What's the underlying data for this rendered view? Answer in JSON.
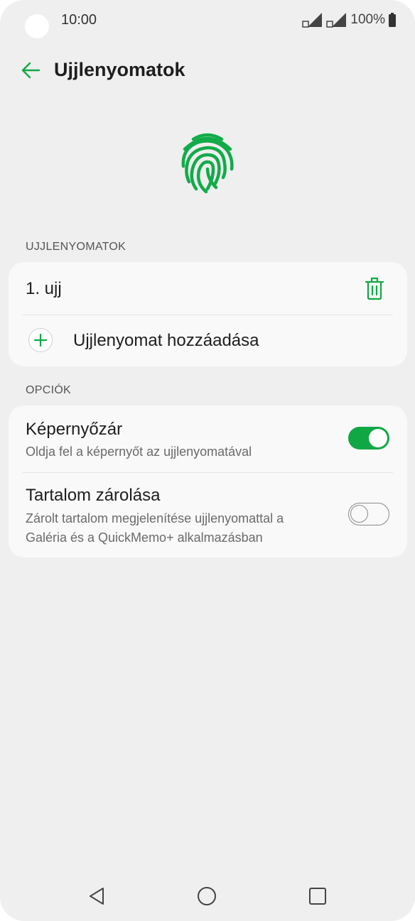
{
  "status_bar": {
    "time": "10:00",
    "battery": "100%"
  },
  "header": {
    "title": "Ujjlenyomatok"
  },
  "fingerprints_section": {
    "label": "UJJLENYOMATOK",
    "items": [
      {
        "label": "1. ujj"
      }
    ],
    "add_label": "Ujjlenyomat hozzáadása"
  },
  "options_section": {
    "label": "OPCIÓK",
    "items": [
      {
        "title": "Képernyőzár",
        "subtitle": "Oldja fel a képernyőt az ujjlenyomatával",
        "enabled": true
      },
      {
        "title": "Tartalom zárolása",
        "subtitle": "Zárolt tartalom megjelenítése ujjlenyomattal a Galéria és a QuickMemo+ alkalmazásban",
        "enabled": false
      }
    ]
  },
  "colors": {
    "accent": "#10a845",
    "background": "#efefef",
    "card": "#f9f9f9"
  },
  "icons": {
    "back": "arrow-left-icon",
    "fingerprint": "fingerprint-icon",
    "delete": "trash-icon",
    "add": "plus-icon"
  }
}
